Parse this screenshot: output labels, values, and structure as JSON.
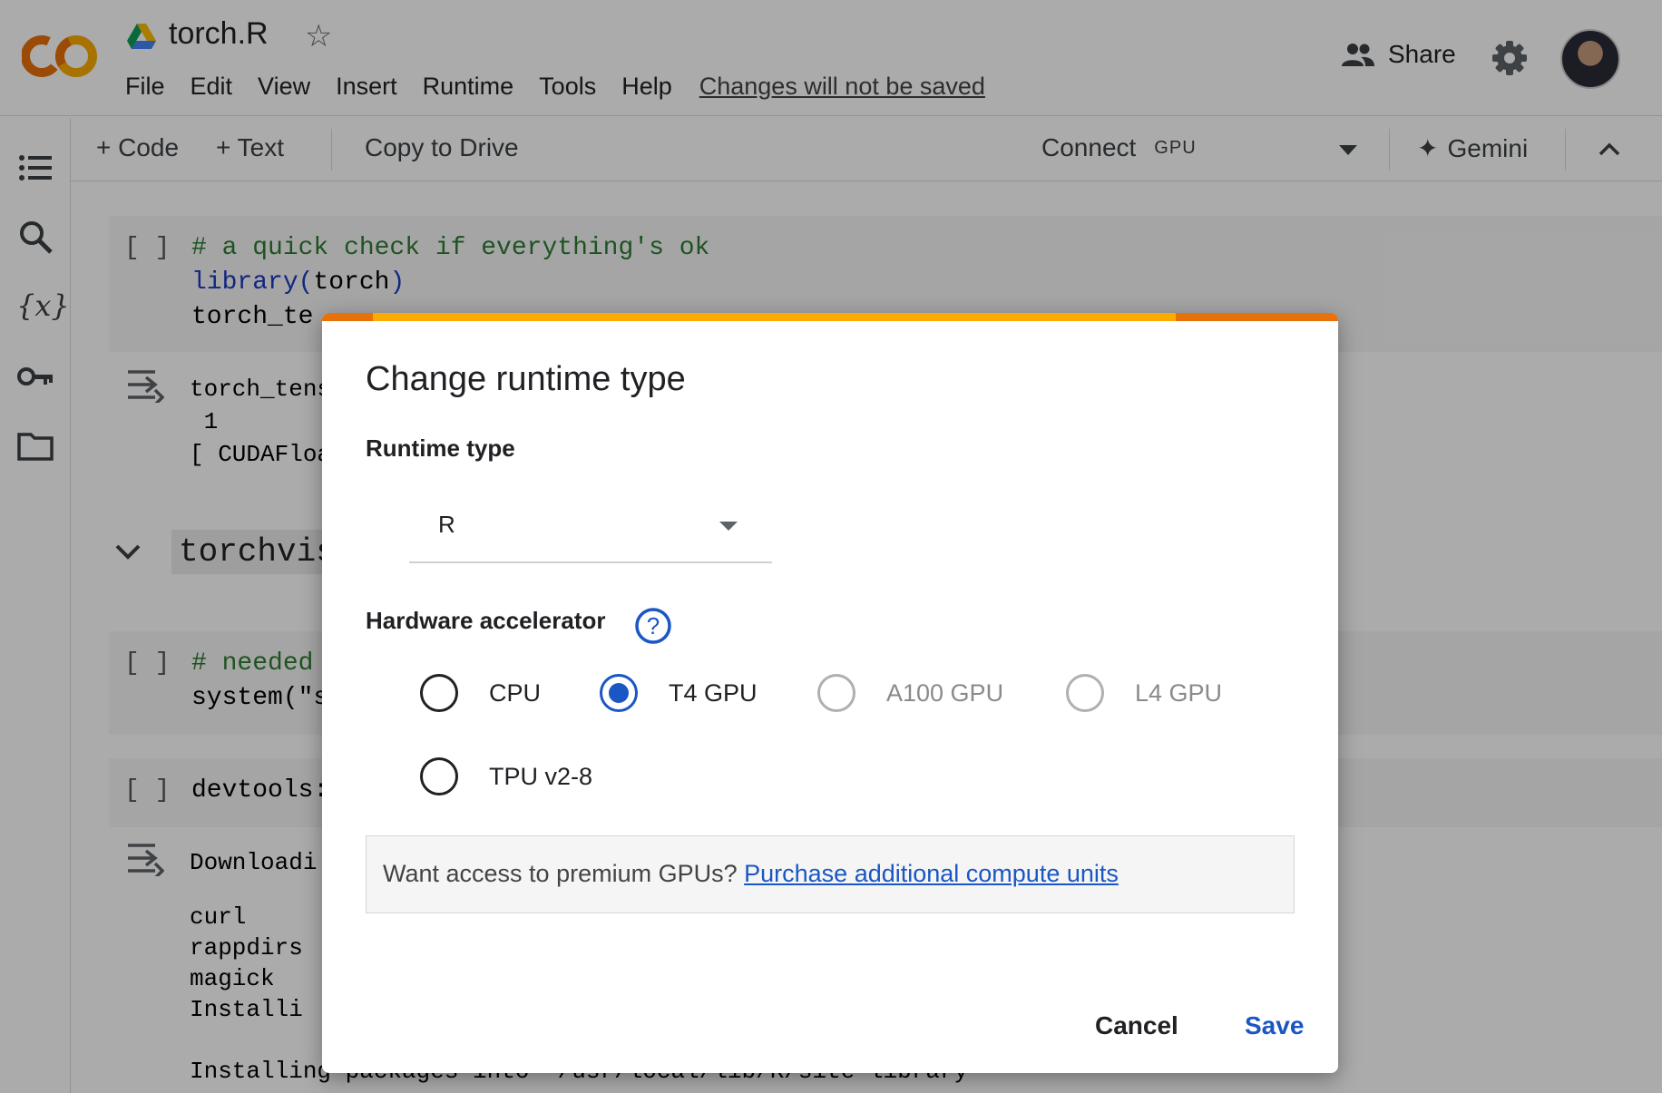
{
  "header": {
    "title": "torch.R",
    "menu": [
      "File",
      "Edit",
      "View",
      "Insert",
      "Runtime",
      "Tools",
      "Help"
    ],
    "changes_notice": "Changes will not be saved",
    "share_label": "Share"
  },
  "toolbar": {
    "add_code": "+ Code",
    "add_text": "+ Text",
    "copy_to_drive": "Copy to Drive",
    "connect": "Connect",
    "connect_badge": "GPU",
    "gemini": "Gemini"
  },
  "notebook": {
    "cell1": {
      "bracket": "[ ]",
      "comment": "# a quick check if everything's ok",
      "line2_fn": "library(",
      "line2_arg": "torch",
      "line2_close": ")",
      "line3": "torch_te"
    },
    "output1": [
      "torch_tens",
      " 1",
      "[ CUDAFloa"
    ],
    "section_heading": "torchvis",
    "cell2": {
      "bracket": "[ ]",
      "comment": "# needed",
      "line2": "system(\"s"
    },
    "cell3": {
      "bracket": "[ ]",
      "line1": "devtools:"
    },
    "output3": [
      "Downloadi",
      "",
      "curl",
      "rappdirs",
      "magick",
      "Installi",
      "",
      "Installing packages into '/usr/local/lib/R/site-library'"
    ]
  },
  "dialog": {
    "title": "Change runtime type",
    "runtime_label": "Runtime type",
    "runtime_value": "R",
    "accelerator_label": "Hardware accelerator",
    "options": [
      {
        "label": "CPU",
        "checked": false,
        "disabled": false
      },
      {
        "label": "T4 GPU",
        "checked": true,
        "disabled": false
      },
      {
        "label": "A100 GPU",
        "checked": false,
        "disabled": true
      },
      {
        "label": "L4 GPU",
        "checked": false,
        "disabled": true
      },
      {
        "label": "TPU v2-8",
        "checked": false,
        "disabled": false
      }
    ],
    "promo_text": "Want access to premium GPUs?",
    "promo_link": "Purchase additional compute units",
    "cancel": "Cancel",
    "save": "Save"
  },
  "colors": {
    "accent": "#1a56c4",
    "dialog_bar_orange": "#f9ab00",
    "dialog_bar_dark": "#e8710a"
  }
}
